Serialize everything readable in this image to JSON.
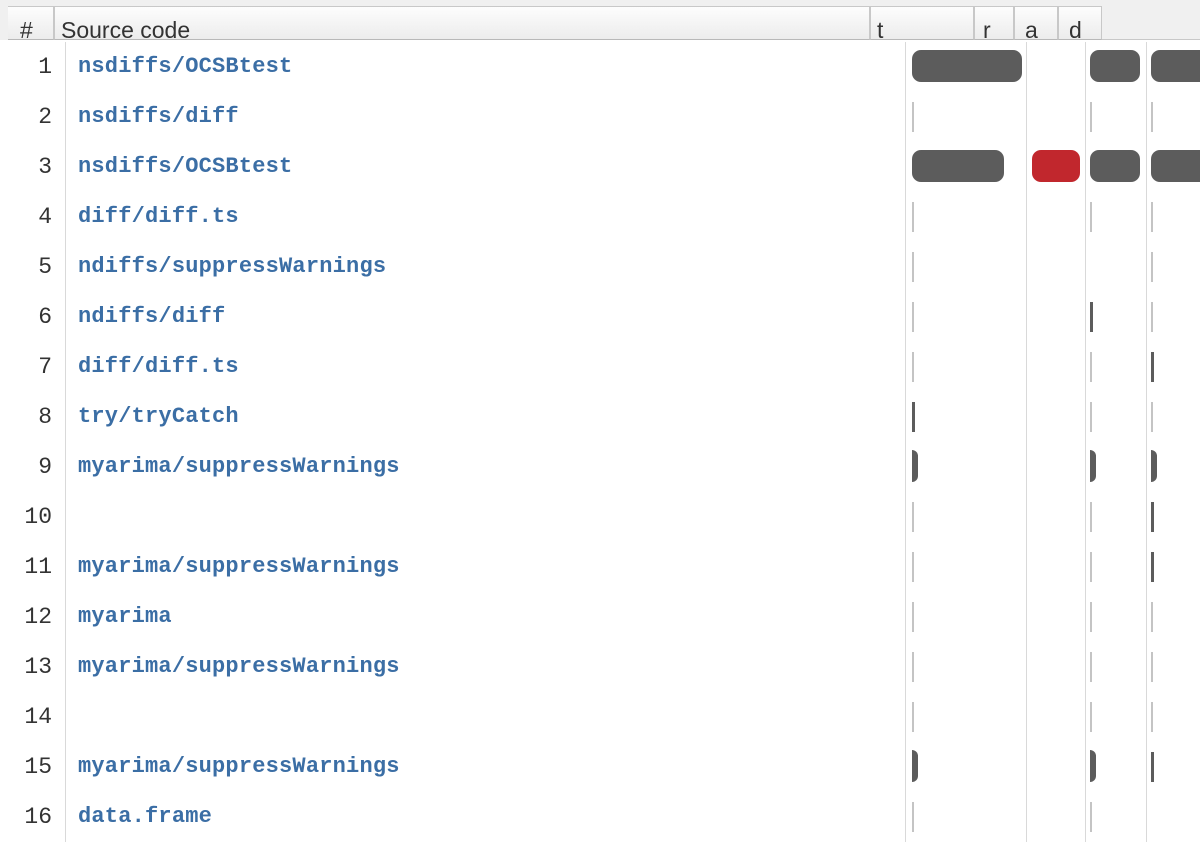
{
  "header": {
    "num": "#",
    "source": "Source code",
    "t": "t",
    "r": "r",
    "a": "a",
    "d": "d"
  },
  "rows": [
    {
      "num": "1",
      "code": "nsdiffs/OCSBtest",
      "t": "bar-large",
      "a": "none",
      "d": "bar",
      "e": "bar"
    },
    {
      "num": "2",
      "code": "nsdiffs/diff",
      "t": "tick",
      "a": "none",
      "d": "tick",
      "e": "tick"
    },
    {
      "num": "3",
      "code": "nsdiffs/OCSBtest",
      "t": "bar-medium",
      "a": "red-bar",
      "d": "bar",
      "e": "bar"
    },
    {
      "num": "4",
      "code": "diff/diff.ts",
      "t": "tick",
      "a": "none",
      "d": "tick",
      "e": "tick"
    },
    {
      "num": "5",
      "code": "ndiffs/suppressWarnings",
      "t": "tick",
      "a": "none",
      "d": "none",
      "e": "tick"
    },
    {
      "num": "6",
      "code": "ndiffs/diff",
      "t": "tick",
      "a": "none",
      "d": "thin",
      "e": "tick"
    },
    {
      "num": "7",
      "code": "diff/diff.ts",
      "t": "tick",
      "a": "none",
      "d": "tick",
      "e": "thin"
    },
    {
      "num": "8",
      "code": "try/tryCatch",
      "t": "thin",
      "a": "none",
      "d": "tick",
      "e": "tick"
    },
    {
      "num": "9",
      "code": "myarima/suppressWarnings",
      "t": "stub",
      "a": "none",
      "d": "stub",
      "e": "stub"
    },
    {
      "num": "10",
      "code": "",
      "t": "tick",
      "a": "none",
      "d": "tick",
      "e": "thin"
    },
    {
      "num": "11",
      "code": "myarima/suppressWarnings",
      "t": "tick",
      "a": "none",
      "d": "tick",
      "e": "thin"
    },
    {
      "num": "12",
      "code": "myarima",
      "t": "tick",
      "a": "none",
      "d": "tick",
      "e": "tick"
    },
    {
      "num": "13",
      "code": "myarima/suppressWarnings",
      "t": "tick",
      "a": "none",
      "d": "tick",
      "e": "tick"
    },
    {
      "num": "14",
      "code": "",
      "t": "tick",
      "a": "none",
      "d": "tick",
      "e": "tick"
    },
    {
      "num": "15",
      "code": "myarima/suppressWarnings",
      "t": "stub",
      "a": "none",
      "d": "stub",
      "e": "thin"
    },
    {
      "num": "16",
      "code": "data.frame",
      "t": "tick",
      "a": "none",
      "d": "tick",
      "e": "none"
    }
  ]
}
